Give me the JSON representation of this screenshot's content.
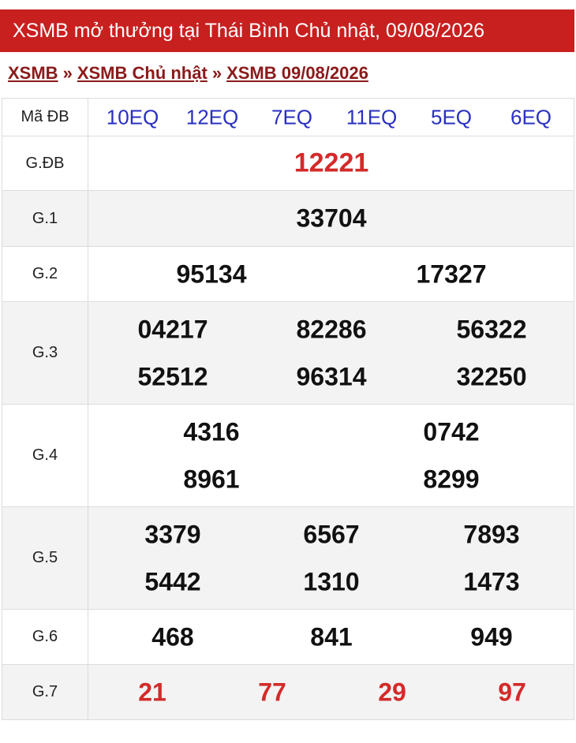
{
  "header": {
    "title": "XSMB mở thưởng tại Thái Bình Chủ nhật, 09/08/2026"
  },
  "breadcrumb": {
    "items": [
      "XSMB",
      "XSMB Chủ nhật",
      "XSMB 09/08/2026"
    ],
    "separator": "»"
  },
  "table": {
    "code_label": "Mã ĐB",
    "codes": [
      "10EQ",
      "12EQ",
      "7EQ",
      "11EQ",
      "5EQ",
      "6EQ"
    ],
    "prizes": {
      "gdb": {
        "label": "G.ĐB",
        "numbers": [
          "12221"
        ]
      },
      "g1": {
        "label": "G.1",
        "numbers": [
          "33704"
        ]
      },
      "g2": {
        "label": "G.2",
        "numbers": [
          "95134",
          "17327"
        ]
      },
      "g3": {
        "label": "G.3",
        "numbers": [
          "04217",
          "82286",
          "56322",
          "52512",
          "96314",
          "32250"
        ]
      },
      "g4": {
        "label": "G.4",
        "numbers": [
          "4316",
          "0742",
          "8961",
          "8299"
        ]
      },
      "g5": {
        "label": "G.5",
        "numbers": [
          "3379",
          "6567",
          "7893",
          "5442",
          "1310",
          "1473"
        ]
      },
      "g6": {
        "label": "G.6",
        "numbers": [
          "468",
          "841",
          "949"
        ]
      },
      "g7": {
        "label": "G.7",
        "numbers": [
          "21",
          "77",
          "29",
          "97"
        ]
      }
    }
  },
  "colors": {
    "header_bg": "#c8201f",
    "breadcrumb": "#8b1a1a",
    "code": "#2a30c0",
    "highlight": "#d42a2a"
  }
}
